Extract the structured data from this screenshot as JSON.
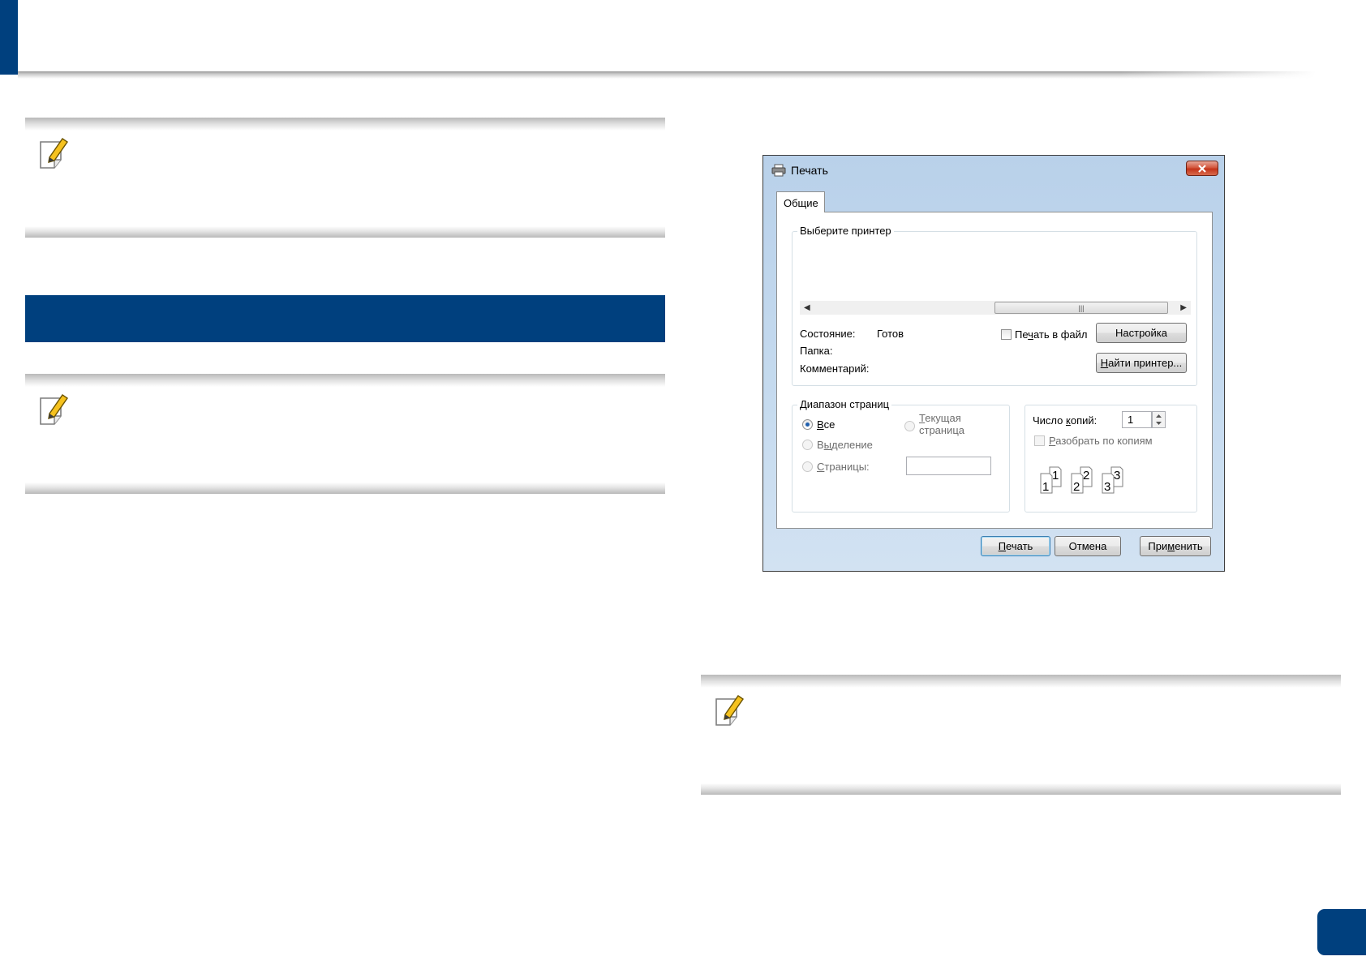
{
  "dialog": {
    "title": "Печать",
    "tab_general": "Общие",
    "select_printer_label": "Выберите принтер",
    "status_label": "Состояние:",
    "status_value": "Готов",
    "folder_label": "Папка:",
    "comment_label": "Комментарий:",
    "print_to_file_pre": "Пе",
    "print_to_file_key": "ч",
    "print_to_file_post": "ать в файл",
    "settings_button": "Настройка",
    "find_printer_key": "Н",
    "find_printer_post": "айти принтер...",
    "page_range_label": "Диапазон страниц",
    "all_key": "В",
    "all_post": "се",
    "selection_pre": "В",
    "selection_key": "ы",
    "selection_post": "деление",
    "current_key": "Т",
    "current_line1_post": "екущая",
    "current_line2": "страница",
    "pages_key": "С",
    "pages_post": "траницы:",
    "copies_pre": "Число ",
    "copies_key": "к",
    "copies_post": "опий:",
    "copies_value": "1",
    "collate_key": "Р",
    "collate_post": "азобрать по копиям",
    "print_key": "П",
    "print_post": "ечать",
    "cancel_button": "Отмена",
    "apply_pre": "При",
    "apply_key": "м",
    "apply_post": "енить",
    "collate_pages": [
      "1",
      "1",
      "2",
      "2",
      "3",
      "3"
    ]
  },
  "colors": {
    "brand_blue": "#00407e"
  },
  "icons": {
    "note": "note-pencil-icon",
    "printer": "printer-icon",
    "close": "close-icon"
  }
}
